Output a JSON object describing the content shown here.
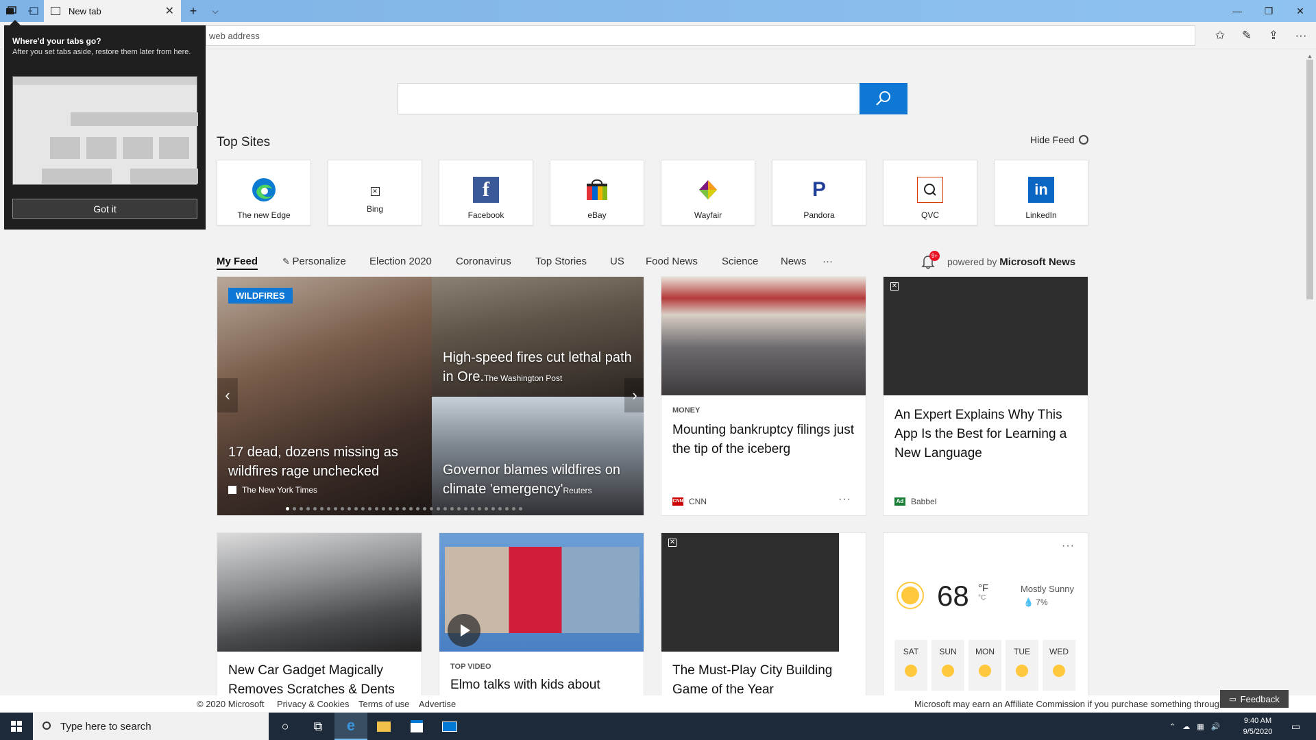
{
  "browser": {
    "tab_title": "New tab",
    "address_placeholder": "web address"
  },
  "flyout": {
    "title": "Where'd your tabs go?",
    "description": "After you set tabs aside, restore them later from here.",
    "button": "Got it"
  },
  "newtab": {
    "top_sites_title": "Top Sites",
    "hide_feed": "Hide Feed",
    "top_sites": [
      {
        "label": "The new Edge",
        "icon": "edge-icon",
        "color": "#0c7bd1"
      },
      {
        "label": "Bing",
        "icon": "bing-icon",
        "color": "#333333"
      },
      {
        "label": "Facebook",
        "icon": "facebook-icon",
        "color": "#3b5998"
      },
      {
        "label": "eBay",
        "icon": "ebay-icon",
        "color": "#e53238"
      },
      {
        "label": "Wayfair",
        "icon": "wayfair-icon",
        "color": "#7f187f"
      },
      {
        "label": "Pandora",
        "icon": "pandora-icon",
        "color": "#224099"
      },
      {
        "label": "QVC",
        "icon": "qvc-icon",
        "color": "#d83b01"
      },
      {
        "label": "LinkedIn",
        "icon": "linkedin-icon",
        "color": "#0a66c2"
      }
    ],
    "feed_tabs": [
      "My Feed",
      "Personalize",
      "Election 2020",
      "Coronavirus",
      "Top Stories",
      "US",
      "Food News",
      "Science",
      "News",
      "···"
    ],
    "notification_count": "9+",
    "powered_by_prefix": "powered by",
    "powered_by_brand": "Microsoft News"
  },
  "cards": {
    "hero": {
      "tag": "WILDFIRES",
      "left_headline": "17 dead, dozens missing as wildfires rage unchecked",
      "left_source": "The New York Times",
      "rt_headline": "High-speed fires cut lethal path in Ore.",
      "rt_source": "The Washington Post",
      "rb_headline": "Governor blames wildfires on climate 'emergency'",
      "rb_source": "Reuters"
    },
    "money": {
      "category": "MONEY",
      "title": "Mounting bankruptcy filings just the tip of the iceberg",
      "source": "CNN",
      "more": "···"
    },
    "babbel": {
      "title": "An Expert Explains Why This App Is the Best for Learning a New Language",
      "ad_label": "Ad",
      "source": "Babbel"
    },
    "car": {
      "title": "New Car Gadget Magically Removes Scratches & Dents"
    },
    "video": {
      "category": "TOP VIDEO",
      "title": "Elmo talks with kids about"
    },
    "game": {
      "title": "The Must-Play City Building Game of the Year"
    },
    "weather": {
      "more": "···",
      "temp": "68",
      "unit_f": "°F",
      "unit_c": "°C",
      "condition": "Mostly Sunny",
      "precip": "7%",
      "days": [
        "SAT",
        "SUN",
        "MON",
        "TUE",
        "WED"
      ]
    }
  },
  "footer": {
    "copyright": "© 2020 Microsoft",
    "privacy": "Privacy & Cookies",
    "terms": "Terms of use",
    "advertise": "Advertise",
    "affiliate": "Microsoft may earn an Affiliate Commission if you purchase something through recommended links in this page.",
    "feedback": "Feedback"
  },
  "taskbar": {
    "search_placeholder": "Type here to search",
    "time": "9:40 AM",
    "date": "9/5/2020"
  }
}
